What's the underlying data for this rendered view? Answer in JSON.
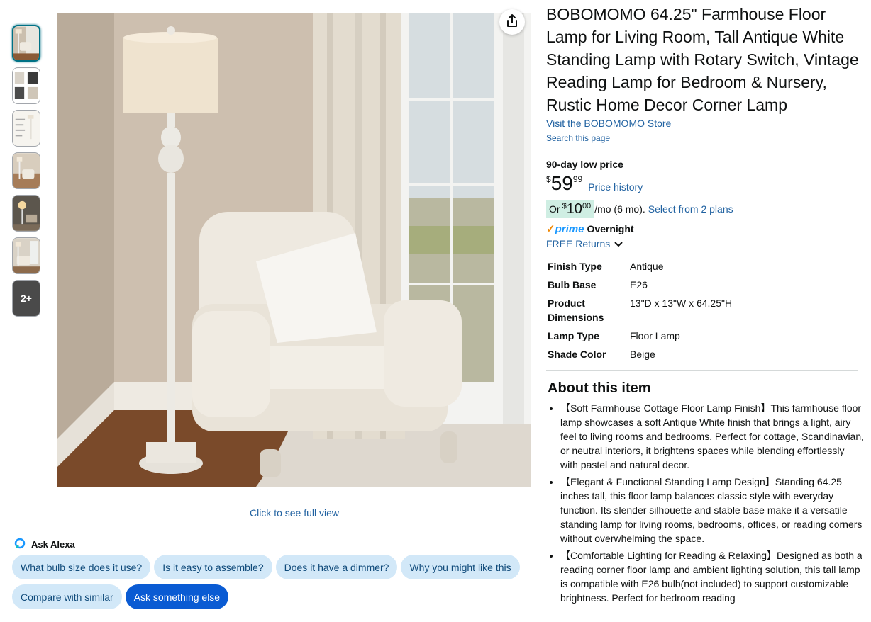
{
  "thumbnails": {
    "count": 6,
    "selected_index": 0,
    "more_label": "2+"
  },
  "image": {
    "full_view_label": "Click to see full view"
  },
  "alexa": {
    "label": "Ask Alexa",
    "chips_row1": [
      "What bulb size does it use?",
      "Is it easy to assemble?",
      "Does it have a dimmer?",
      "Why you might like this"
    ],
    "chips_row2": [
      "Compare with similar",
      "Ask something else"
    ]
  },
  "product": {
    "title": "BOBOMOMO 64.25\" Farmhouse Floor Lamp for Living Room, Tall Antique White Standing Lamp with Rotary Switch, Vintage Reading Lamp for Bedroom & Nursery, Rustic Home Decor Corner Lamp",
    "store_link": "Visit the BOBOMOMO Store",
    "search_page": "Search this page"
  },
  "pricing": {
    "low_price_label": "90-day low price",
    "currency": "$",
    "price_whole": "59",
    "price_fraction": "99",
    "price_history": "Price history",
    "monthly_or": "Or",
    "monthly_whole": "10",
    "monthly_fraction": "00",
    "monthly_suffix": "/mo (6 mo).",
    "plans_link": "Select from 2 plans"
  },
  "delivery": {
    "prime": "prime",
    "overnight": "Overnight",
    "returns": "FREE Returns"
  },
  "specs": [
    {
      "key": "Finish Type",
      "value": "Antique"
    },
    {
      "key": "Bulb Base",
      "value": "E26"
    },
    {
      "key": "Product Dimensions",
      "value": "13\"D x 13\"W x 64.25\"H"
    },
    {
      "key": "Lamp Type",
      "value": "Floor Lamp"
    },
    {
      "key": "Shade Color",
      "value": "Beige"
    }
  ],
  "about": {
    "heading": "About this item",
    "bullets": [
      "【Soft Farmhouse Cottage Floor Lamp Finish】This farmhouse floor lamp showcases a soft Antique White finish that brings a light, airy feel to living rooms and bedrooms. Perfect for cottage, Scandinavian, or neutral interiors, it brightens spaces while blending effortlessly with pastel and natural decor.",
      "【Elegant & Functional Standing Lamp Design】Standing 64.25 inches tall, this floor lamp balances classic style with everyday function. Its slender silhouette and stable base make it a versatile standing lamp for living rooms, bedrooms, offices, or reading corners without overwhelming the space.",
      "【Comfortable Lighting for Reading & Relaxing】Designed as both a reading corner floor lamp and ambient lighting solution, this tall lamp is compatible with E26 bulb(not included) to support customizable brightness. Perfect for bedroom reading"
    ]
  },
  "colors": {
    "link": "#2162a1",
    "chip_bg": "#d2e8f8",
    "chip_primary": "#0a5bd3",
    "deal_bg": "#cfeee3",
    "prime": "#1a98ff"
  }
}
